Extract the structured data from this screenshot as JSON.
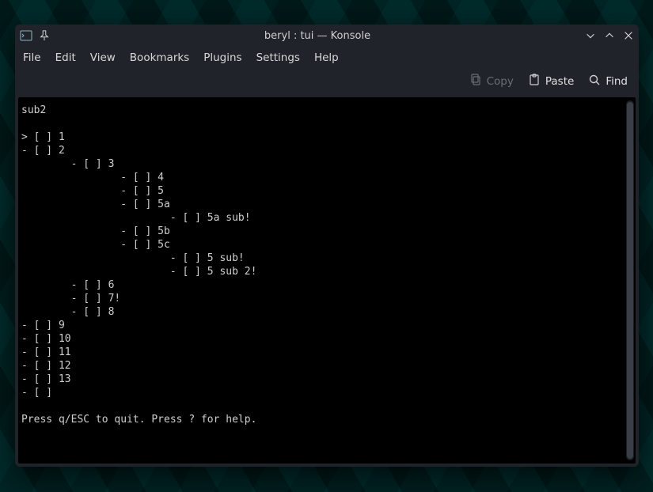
{
  "window": {
    "title": "beryl : tui — Konsole"
  },
  "menubar": {
    "items": [
      "File",
      "Edit",
      "View",
      "Bookmarks",
      "Plugins",
      "Settings",
      "Help"
    ]
  },
  "toolbar": {
    "copy": "Copy",
    "paste": "Paste",
    "find": "Find"
  },
  "terminal": {
    "header": "sub2",
    "lines": [
      "> [ ] 1",
      "- [ ] 2",
      "        - [ ] 3",
      "                - [ ] 4",
      "                - [ ] 5",
      "                - [ ] 5a",
      "                        - [ ] 5a sub!",
      "                - [ ] 5b",
      "                - [ ] 5c",
      "                        - [ ] 5 sub!",
      "                        - [ ] 5 sub 2!",
      "        - [ ] 6",
      "        - [ ] 7!",
      "        - [ ] 8",
      "- [ ] 9",
      "- [ ] 10",
      "- [ ] 11",
      "- [ ] 12",
      "- [ ] 13",
      "- [ ] "
    ],
    "footer": "Press q/ESC to quit. Press ? for help."
  }
}
